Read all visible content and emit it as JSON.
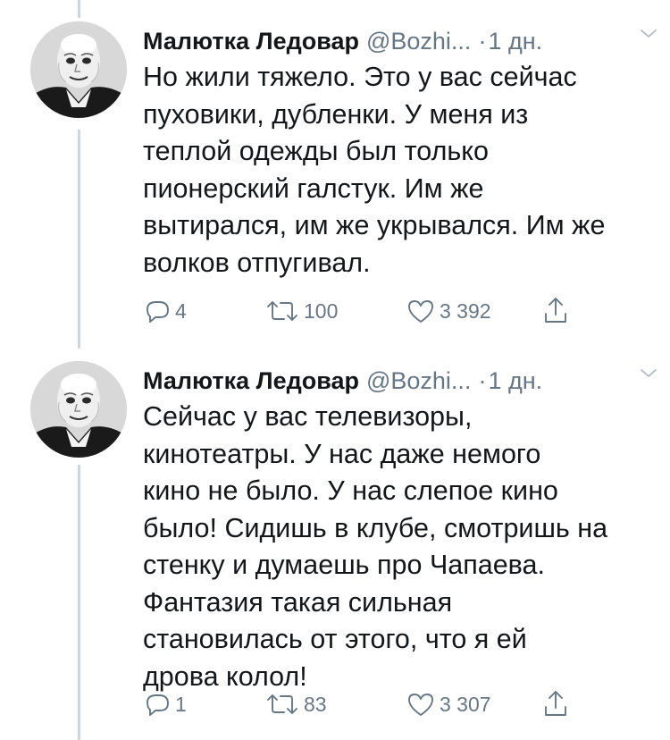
{
  "tweets": [
    {
      "author_name": "Малютка Ледовар",
      "handle": "@Bozhi...",
      "separator": "·",
      "time": "1 дн.",
      "text": "Но жили тяжело. Это у вас сейчас\nпуховики, дубленки. У меня из\nтеплой одежды был только\nпионерский галстук. Им же\nвытирался, им же укрывался. Им же\nволков отпугивал.",
      "replies": "4",
      "retweets": "100",
      "likes": "3 392"
    },
    {
      "author_name": "Малютка Ледовар",
      "handle": "@Bozhi...",
      "separator": "·",
      "time": "1 дн.",
      "text": "Сейчас у вас телевизоры,\nкинотеатры. У нас даже немого\nкино не было. У нас слепое кино\nбыло! Сидишь в клубе, смотришь на\nстенку и думаешь про Чапаева.\nФантазия такая сильная\nстановилась от этого, что я ей\nдрова колол!",
      "replies": "1",
      "retweets": "83",
      "likes": "3 307"
    }
  ],
  "icons": {
    "avatar": "avatar-portrait",
    "caret": "chevron-down-icon",
    "reply": "reply-icon",
    "retweet": "retweet-icon",
    "like": "heart-icon",
    "share": "share-icon"
  },
  "colors": {
    "text": "#14171a",
    "secondary": "#657786",
    "thread_line": "#ccd6dd"
  }
}
